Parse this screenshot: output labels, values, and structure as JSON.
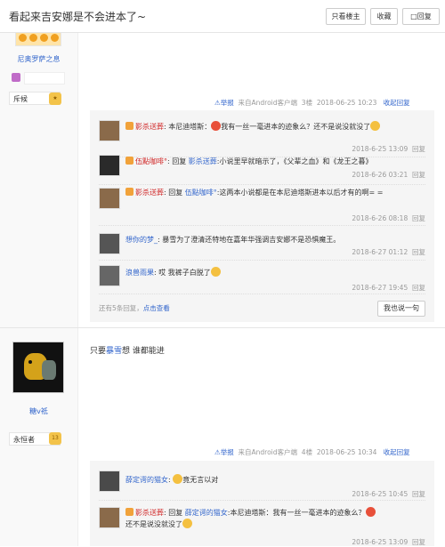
{
  "header": {
    "title": "看起来吉安娜是不会进本了~",
    "only_op": "只看楼主",
    "collect": "收藏",
    "reply": "回复"
  },
  "post3": {
    "author_name": "尼奥罗萨之息",
    "rank": "斥候",
    "meta": {
      "report": "举报",
      "client": "来自Android客户端",
      "floor": "3楼",
      "datetime": "2018-06-25 10:23",
      "collapse": "收起回复"
    },
    "replies": [
      {
        "user": "影杀送葬",
        "text": "本尼迪塔斯：",
        "text2": "我有一丝一毫进本的迹象么？还不是说没就没了",
        "date": "2018-6-25 13:09",
        "action": "回复"
      },
      {
        "user": "伍點咖啡°",
        "text": "回复",
        "target": "影杀送葬",
        "text2": ":小说里早就暗示了，《父辈之血》和《龙王之暮》",
        "date": "2018-6-26 03:21",
        "action": "回复"
      },
      {
        "user": "影杀送葬",
        "text": "回复",
        "target": "伍點咖啡°",
        "text2": ":这两本小说都是在本尼迪塔斯进本以后才有的啊= =",
        "date": "2018-6-26 08:18",
        "action": "回复"
      },
      {
        "user": "想你的梦_",
        "text": "暴雪为了澄清还特地在嘉年华强调吉安娜不是恐惧魔王。",
        "date": "2018-6-27 01:12",
        "action": "回复"
      },
      {
        "user": "浪兽雨果",
        "text": "哎 我裤子白脱了",
        "date": "2018-6-27 19:45",
        "action": "回复"
      }
    ],
    "more_replies": "还有5条回复，",
    "more_link": "点击查看",
    "say_one": "我也说一句"
  },
  "post4": {
    "author_name": "糖v祗",
    "rank": "永恒者",
    "rank_level": "13",
    "body_prefix": "只要",
    "body_link": "暴雪",
    "body_suffix": "想 谁都能进",
    "meta": {
      "report": "举报",
      "client": "来自Android客户端",
      "floor": "4楼",
      "datetime": "2018-06-25 10:34",
      "collapse": "收起回复"
    },
    "replies": [
      {
        "user": "薛定谔的猫女",
        "text": "竟无言以对",
        "date": "2018-6-25 10:45",
        "action": "回复"
      },
      {
        "user": "影杀送葬",
        "text": "回复",
        "target": "薛定谔的猫女",
        "text2": ":本尼迪塔斯：我有一丝一毫进本的迹象么？",
        "text3": "还不是说没就没了",
        "date": "2018-6-25 13:09",
        "action": "回复"
      }
    ]
  },
  "colors": {
    "link": "#3366cc",
    "gray": "#999999",
    "reply_bg": "#f5f5f5"
  }
}
